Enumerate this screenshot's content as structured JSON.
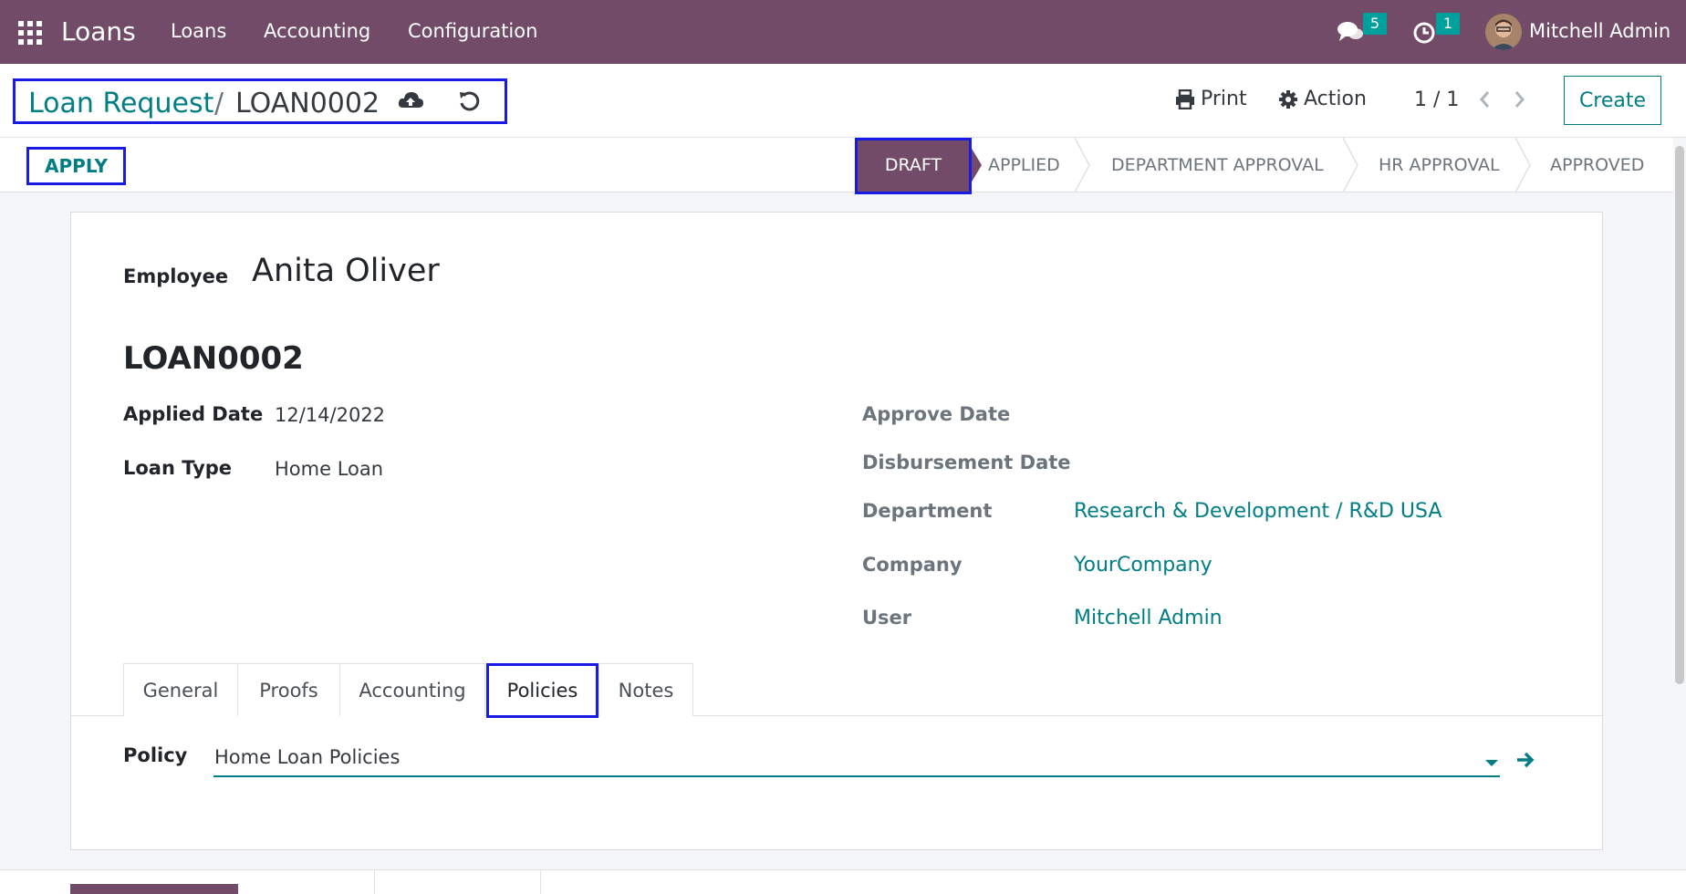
{
  "navbar": {
    "app_name": "Loans",
    "menu": [
      "Loans",
      "Accounting",
      "Configuration"
    ],
    "messages_count": "5",
    "activities_count": "1",
    "user_name": "Mitchell Admin"
  },
  "control_panel": {
    "breadcrumb_parent": "Loan Request",
    "breadcrumb_separator": "/",
    "breadcrumb_current": "LOAN0002",
    "print_label": "Print",
    "action_label": "Action",
    "pager": "1 / 1",
    "create_label": "Create"
  },
  "statusbar": {
    "apply_label": "APPLY",
    "stages": [
      "DRAFT",
      "APPLIED",
      "DEPARTMENT APPROVAL",
      "HR APPROVAL",
      "APPROVED"
    ],
    "active_stage": "DRAFT"
  },
  "form": {
    "employee_label": "Employee",
    "employee_value": "Anita Oliver",
    "title": "LOAN0002",
    "applied_date_label": "Applied Date",
    "applied_date_value": "12/14/2022",
    "loan_type_label": "Loan Type",
    "loan_type_value": "Home Loan",
    "approve_date_label": "Approve Date",
    "disbursement_date_label": "Disbursement Date",
    "department_label": "Department",
    "department_value": "Research & Development / R&D USA",
    "company_label": "Company",
    "company_value": "YourCompany",
    "user_label": "User",
    "user_value": "Mitchell Admin"
  },
  "tabs": [
    "General",
    "Proofs",
    "Accounting",
    "Policies",
    "Notes"
  ],
  "active_tab": "Policies",
  "policies": {
    "policy_label": "Policy",
    "policy_value": "Home Loan Policies"
  },
  "colors": {
    "brand": "#714b67",
    "link": "#017e84",
    "highlight": "#1a1ae6",
    "badge": "#00a09d"
  }
}
